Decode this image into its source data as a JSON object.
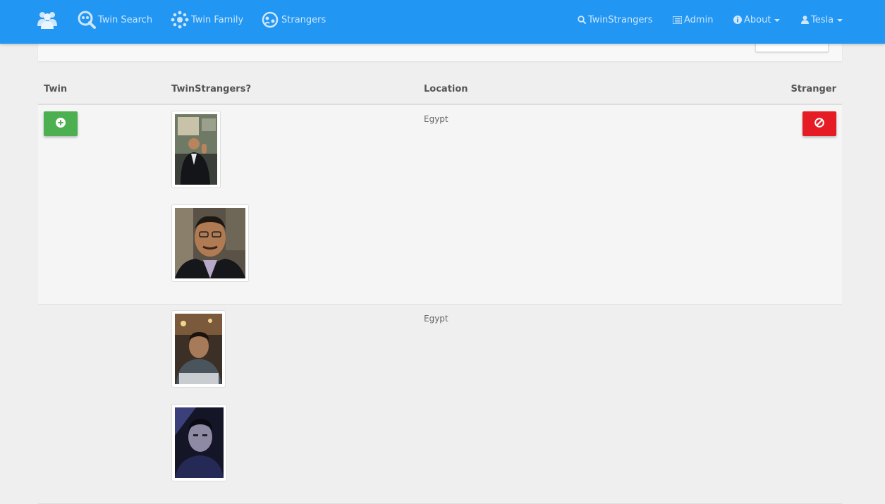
{
  "nav": {
    "logo_icon": "users-icon",
    "twin_search": "Twin Search",
    "twin_family": "Twin Family",
    "strangers": "Strangers",
    "twinstrangers": "TwinStrangers",
    "admin": "Admin",
    "about": "About",
    "user": "Tesla"
  },
  "colors": {
    "navbar": "#2196f3",
    "add_button": "#4caf50",
    "stranger_button": "#e51c23"
  },
  "table": {
    "headers": {
      "twin": "Twin",
      "twinstrangers": "TwinStrangers?",
      "location": "Location",
      "stranger": "Stranger"
    },
    "rows": [
      {
        "location": "Egypt",
        "photos": 2,
        "has_buttons": true
      },
      {
        "location": "Egypt",
        "photos": 2,
        "has_buttons": false
      }
    ]
  }
}
